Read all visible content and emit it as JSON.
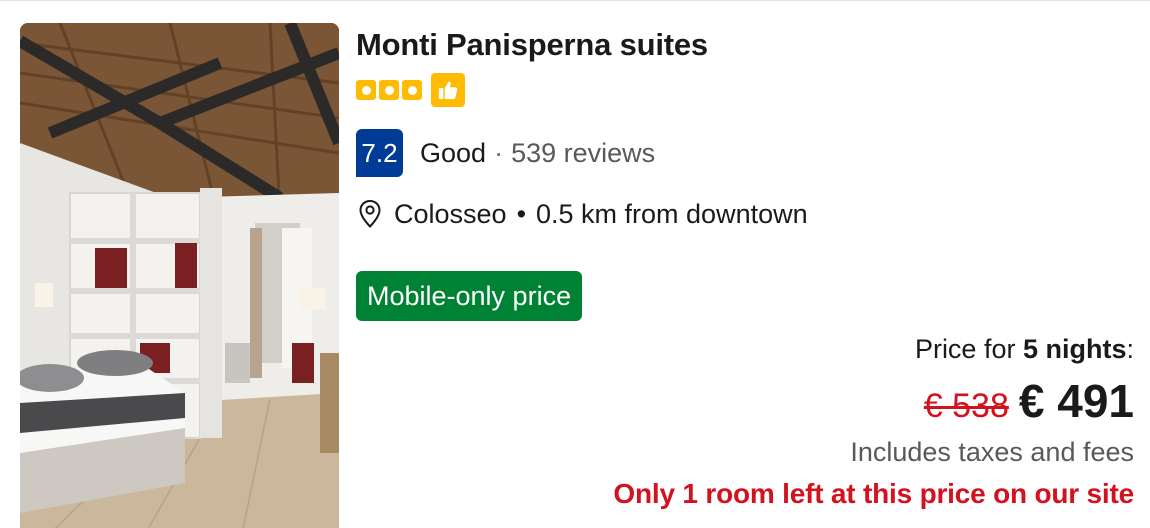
{
  "hotel": {
    "name": "Monti Panisperna suites",
    "star_count": 3,
    "preferred_icon": "thumbs-up-icon"
  },
  "review": {
    "score": "7.2",
    "word": "Good",
    "separator": "·",
    "count": "539 reviews"
  },
  "location": {
    "icon": "map-pin-icon",
    "area": "Colosseo",
    "separator": "•",
    "distance": "0.5 km from downtown"
  },
  "badge": {
    "label": "Mobile-only price"
  },
  "price": {
    "prefix": "Price for ",
    "nights": "5 nights",
    "suffix": ":",
    "original": "€ 538",
    "current": "€ 491",
    "taxes_note": "Includes taxes and fees",
    "scarcity": "Only 1 room left at this price on our site"
  },
  "colors": {
    "score_badge": "#003b95",
    "mobile_badge": "#008234",
    "star": "#febb02",
    "alert_red": "#d4111e"
  }
}
